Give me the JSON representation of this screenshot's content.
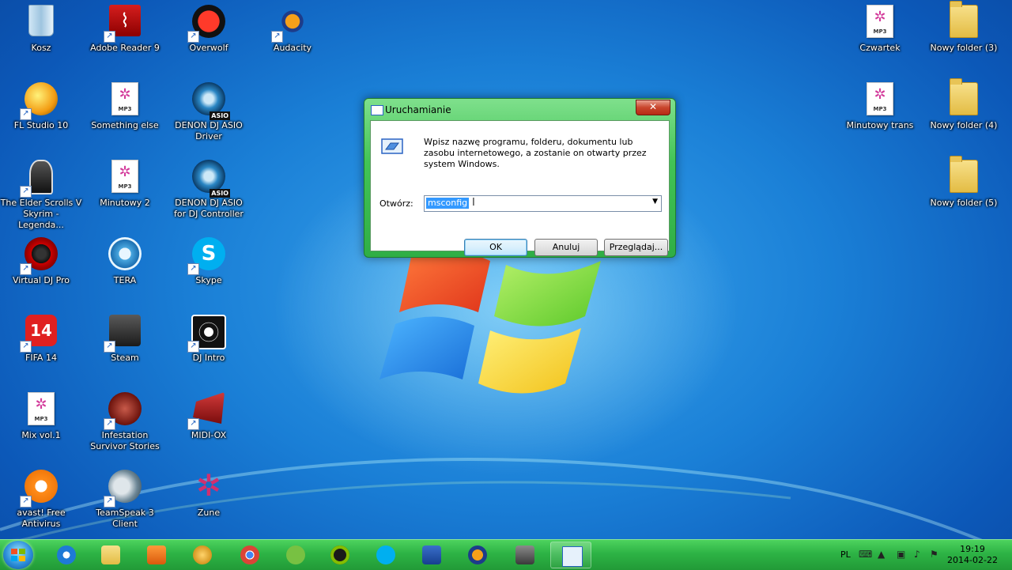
{
  "desktop_icons": [
    {
      "label": "Kosz"
    },
    {
      "label": "Adobe Reader 9"
    },
    {
      "label": "Overwolf"
    },
    {
      "label": "Audacity"
    },
    {
      "label": "FL Studio 10"
    },
    {
      "label": "Something else"
    },
    {
      "label": "DENON DJ ASIO Driver"
    },
    {
      "label": "The Elder Scrolls V Skyrim - Legenda..."
    },
    {
      "label": "Minutowy 2"
    },
    {
      "label": "DENON DJ ASIO for DJ Controller"
    },
    {
      "label": "Virtual DJ Pro"
    },
    {
      "label": "TERA"
    },
    {
      "label": "Skype"
    },
    {
      "label": "FIFA 14"
    },
    {
      "label": "Steam"
    },
    {
      "label": "DJ Intro"
    },
    {
      "label": "Mix vol.1"
    },
    {
      "label": "Infestation Survivor Stories"
    },
    {
      "label": "MIDI-OX"
    },
    {
      "label": "avast! Free Antivirus"
    },
    {
      "label": "TeamSpeak 3 Client"
    },
    {
      "label": "Zune"
    },
    {
      "label": "Czwartek"
    },
    {
      "label": "Nowy folder (3)"
    },
    {
      "label": "Minutowy trans"
    },
    {
      "label": "Nowy folder (4)"
    },
    {
      "label": "Nowy folder (5)"
    }
  ],
  "icon_texts": {
    "mp3": "MP3",
    "asio": "ASIO",
    "fifa": "14"
  },
  "run_dialog": {
    "title": "Uruchamianie",
    "description": "Wpisz nazwę programu, folderu, dokumentu lub zasobu internetowego, a zostanie on otwarty przez system Windows.",
    "open_label": "Otwórz:",
    "input_value": "msconfig",
    "ok_label": "OK",
    "cancel_label": "Anuluj",
    "browse_label": "Przeglądaj..."
  },
  "taskbar": {
    "language": "PL",
    "time": "19:19",
    "date": "2014-02-22"
  }
}
